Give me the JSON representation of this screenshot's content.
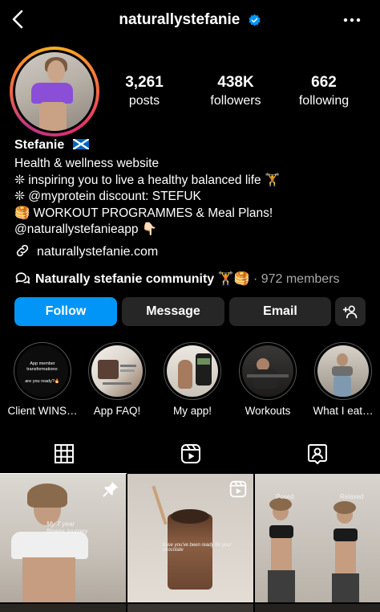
{
  "header": {
    "username": "naturallystefanie",
    "back_icon": "chevron-left-icon",
    "more_icon": "more-horizontal-icon",
    "verified_color": "#0095f6"
  },
  "stats": [
    {
      "value": "3,261",
      "label": "posts"
    },
    {
      "value": "438K",
      "label": "followers"
    },
    {
      "value": "662",
      "label": "following"
    }
  ],
  "profile": {
    "name": "Stefanie",
    "flag_icon": "scotland-flag-icon",
    "bio_lines": [
      "Health & wellness website",
      "❊ inspiring you to live a healthy balanced life 🏋️",
      "❊ @myprotein discount: STEFUK",
      "🥞 WORKOUT PROGRAMMES & Meal Plans!",
      "@naturallystefanieapp 👇🏻"
    ],
    "link": "naturallystefanie.com"
  },
  "community": {
    "name": "Naturally stefanie community",
    "emoji": "🏋️🥞",
    "members": "· 972 members"
  },
  "buttons": {
    "follow": "Follow",
    "message": "Message",
    "email": "Email",
    "follow_color": "#0095f6"
  },
  "highlights": [
    {
      "label": "Client WINS…",
      "cover_text_1": "App member transformations:",
      "cover_text_2": "are you ready?🔥"
    },
    {
      "label": "App FAQ!"
    },
    {
      "label": "My app!"
    },
    {
      "label": "Workouts"
    },
    {
      "label": "What I eat…"
    }
  ],
  "tabs": [
    {
      "name": "posts-grid-icon"
    },
    {
      "name": "reels-icon"
    },
    {
      "name": "tagged-icon"
    }
  ],
  "grid": {
    "post1_caption": "My 7 year fitness journey",
    "post2_caption": "base you've been ready for your chocolate",
    "post3_left": "Posed",
    "post3_right": "Relaxed"
  }
}
